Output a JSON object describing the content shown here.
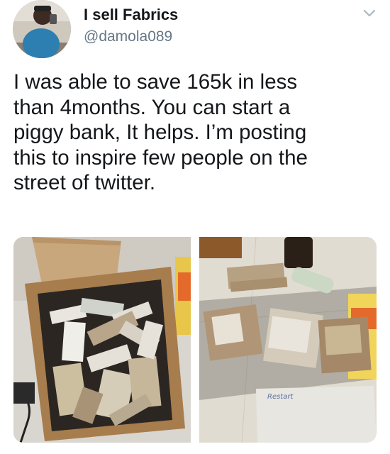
{
  "tweet": {
    "display_name": "I sell Fabrics",
    "handle": "@damola089",
    "text": "I was able to save 165k in less\nthan 4months. You can start a\npiggy bank, It helps. I’m posting\nthis to inspire few people on the\nstreet of twitter.",
    "media": [
      {
        "alt_icon": "money-box-photo"
      },
      {
        "alt_icon": "money-stacks-photo",
        "note_text": "Restart"
      }
    ]
  },
  "icons": {
    "menu": "chevron-down-icon",
    "avatar": "avatar"
  },
  "colors": {
    "text_primary": "#14171a",
    "text_secondary": "#657786",
    "chevron": "#aab8c2"
  }
}
